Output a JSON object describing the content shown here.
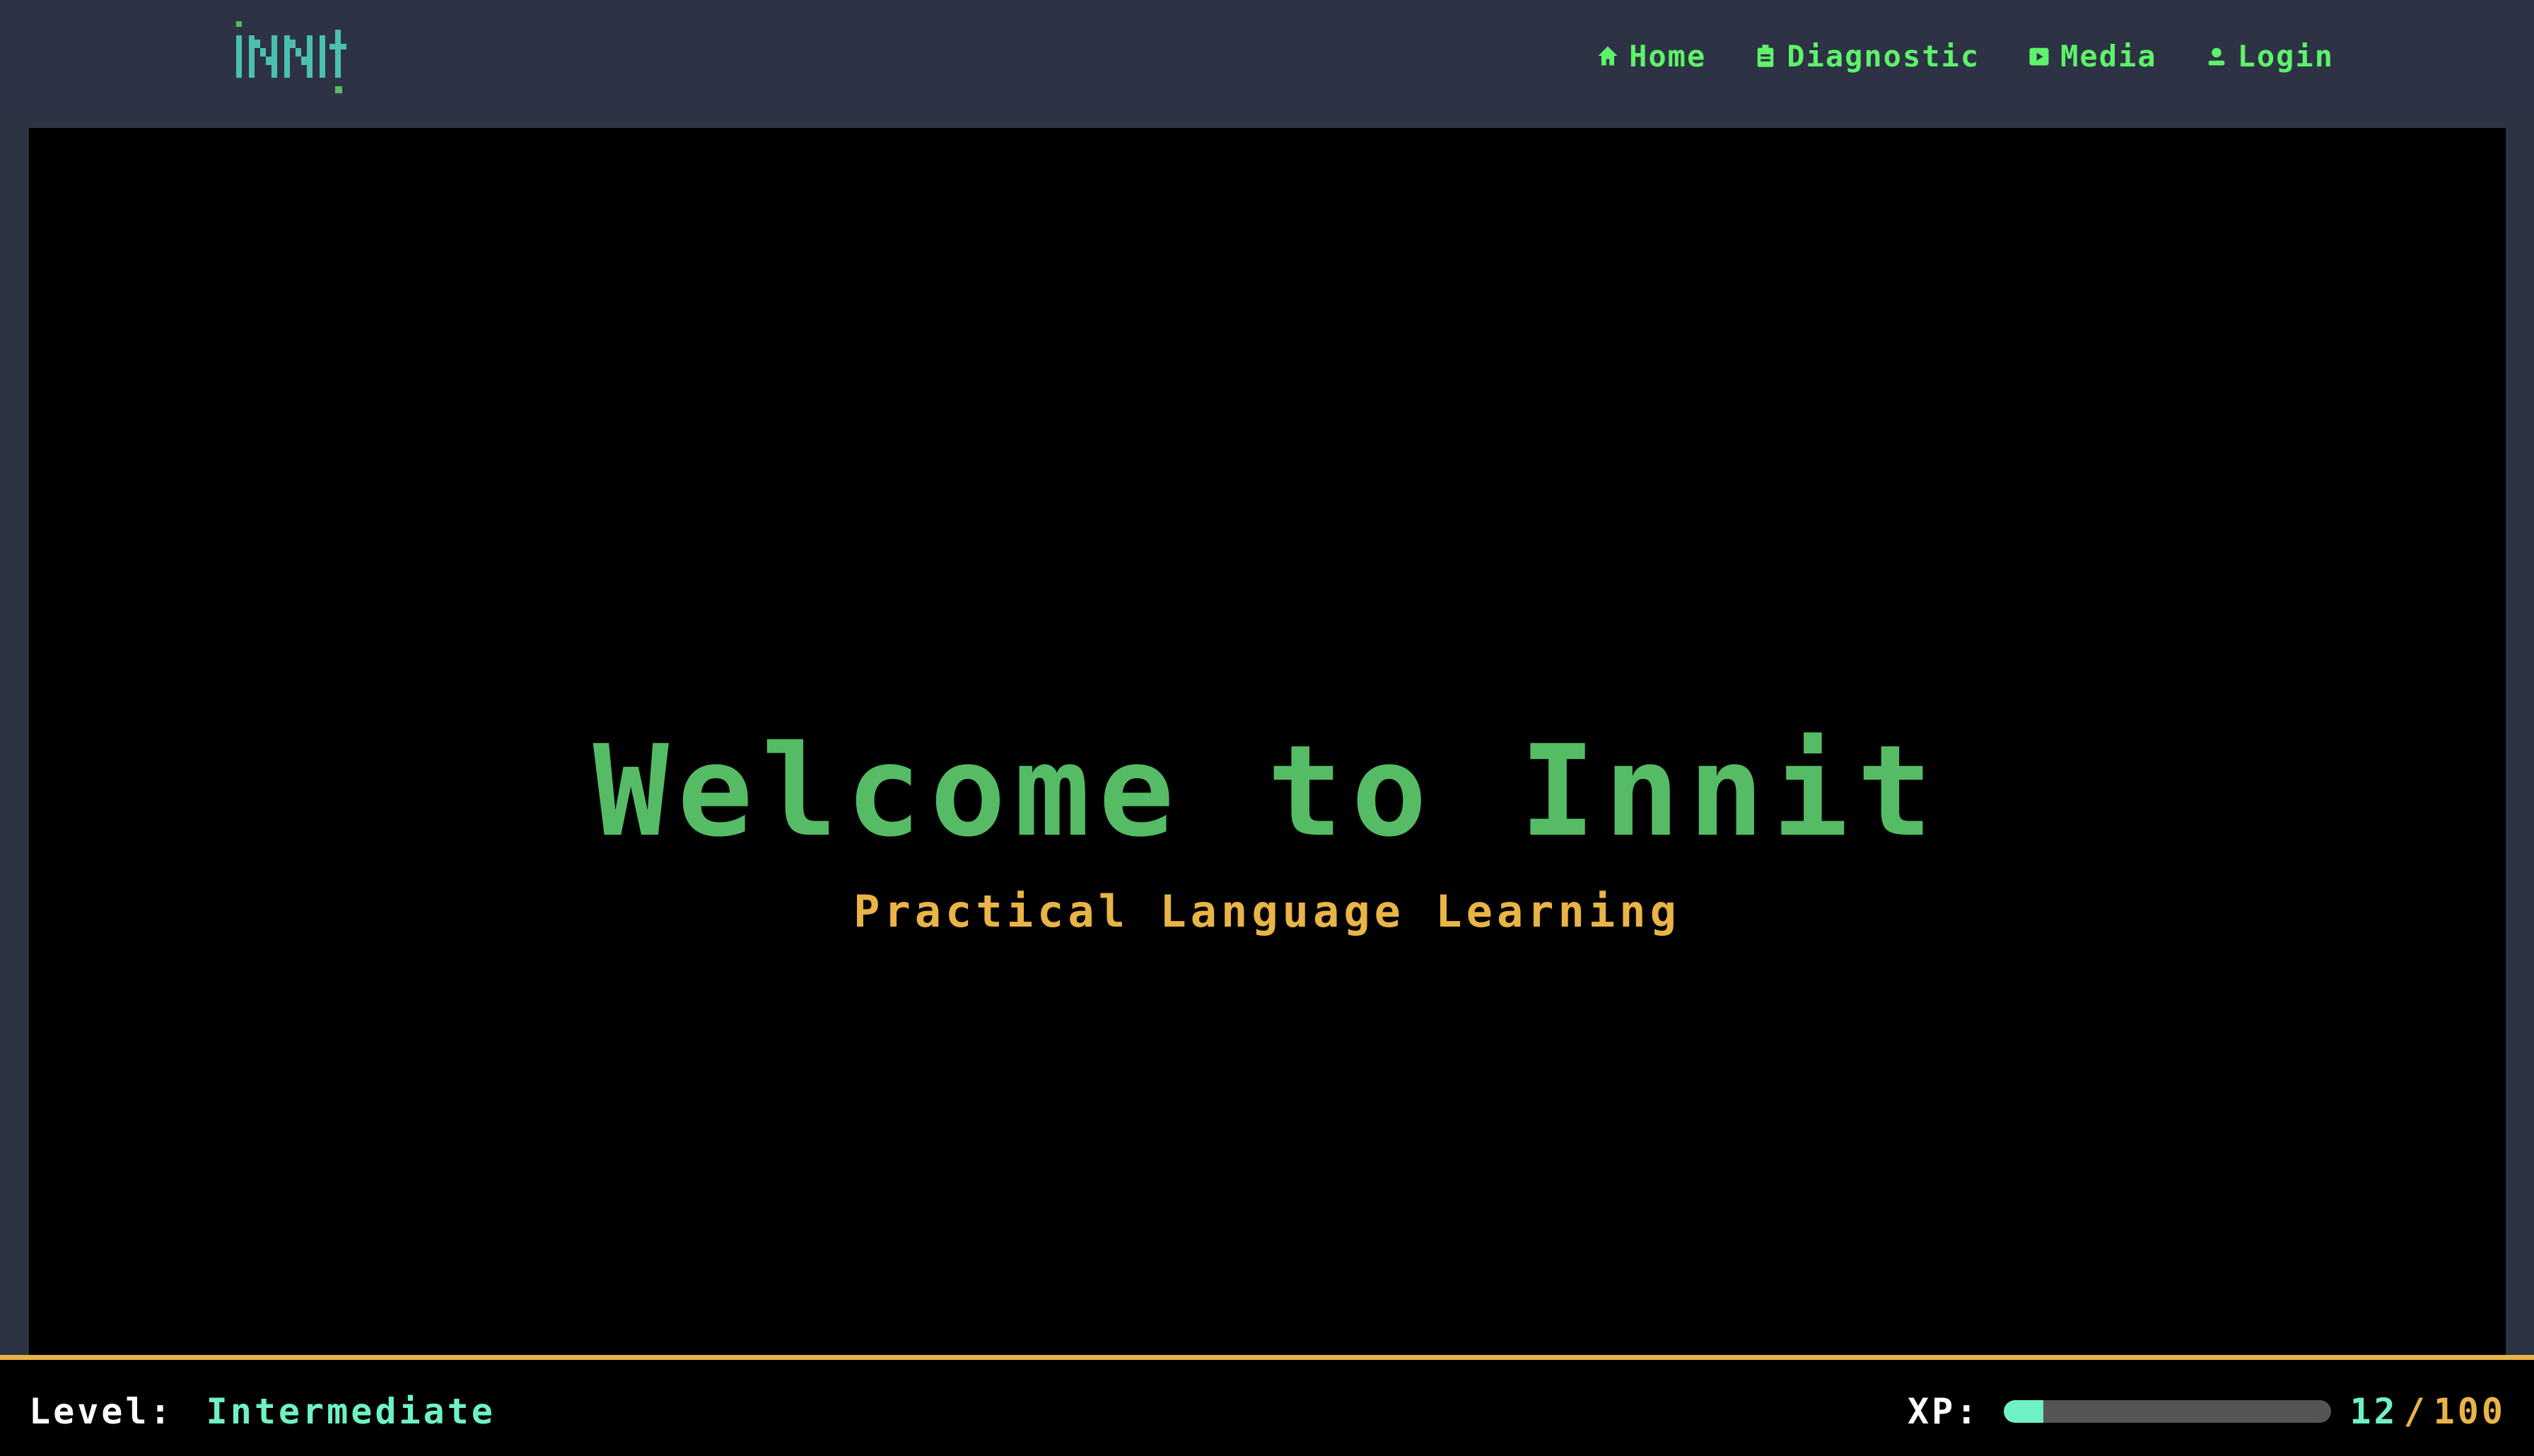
{
  "header": {
    "logo": {
      "text": "INNIT",
      "icon": "innit-logo"
    },
    "nav": [
      {
        "label": "Home",
        "icon": "home-icon"
      },
      {
        "label": "Diagnostic",
        "icon": "clipboard-icon"
      },
      {
        "label": "Media",
        "icon": "media-icon"
      },
      {
        "label": "Login",
        "icon": "user-icon"
      }
    ]
  },
  "hero": {
    "title": "Welcome to Innit",
    "subtitle": "Practical Language Learning"
  },
  "status": {
    "level_label": "Level:",
    "level_value": "Intermediate",
    "xp_label": "XP:",
    "xp_current": "12",
    "xp_separator": "/",
    "xp_max": "100",
    "xp_progress": 0.12
  },
  "colors": {
    "background": "#2d3344",
    "panel": "#000000",
    "nav_text": "#5ef36a",
    "title": "#55bc65",
    "subtitle": "#e9b446",
    "accent_teal": "#6ff2c3",
    "accent_gold": "#e9b446",
    "logo_teal": "#4bc0b0",
    "logo_green": "#55bc65"
  }
}
